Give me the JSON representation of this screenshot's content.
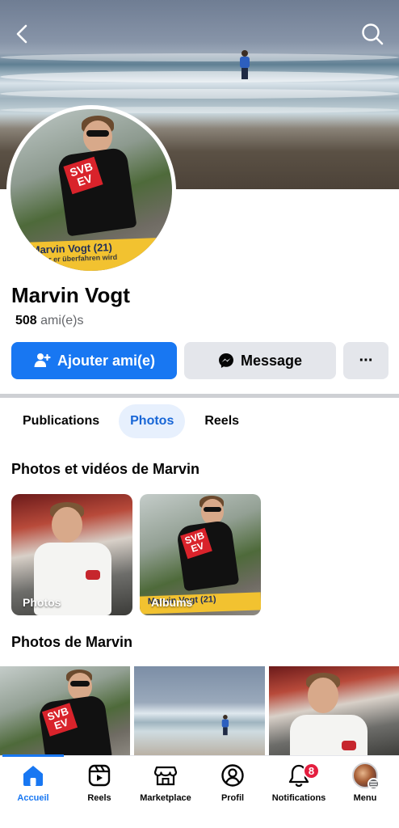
{
  "profile": {
    "name": "Marvin Vogt",
    "friends_count": "508",
    "friends_label": "ami(e)s",
    "avatar_banner": "Marvin Vogt (21)",
    "avatar_banner_sub": "bevor er überfahren wird"
  },
  "actions": {
    "add_friend": "Ajouter ami(e)",
    "message": "Message",
    "more": "···"
  },
  "tabs": [
    {
      "label": "Publications",
      "active": false
    },
    {
      "label": "Photos",
      "active": true
    },
    {
      "label": "Reels",
      "active": false
    }
  ],
  "sections": {
    "albums_title": "Photos et vidéos de Marvin",
    "photos_title": "Photos de Marvin"
  },
  "albums": [
    {
      "label": "Photos"
    },
    {
      "label": "Albums"
    }
  ],
  "shirt_logo": "SVB\nEV",
  "nav": {
    "items": [
      {
        "label": "Accueil",
        "icon": "home-icon",
        "active": true
      },
      {
        "label": "Reels",
        "icon": "reels-icon",
        "active": false
      },
      {
        "label": "Marketplace",
        "icon": "marketplace-icon",
        "active": false
      },
      {
        "label": "Profil",
        "icon": "profile-icon",
        "active": false
      },
      {
        "label": "Notifications",
        "icon": "bell-icon",
        "active": false,
        "badge": "8"
      },
      {
        "label": "Menu",
        "icon": "menu-avatar",
        "active": false
      }
    ]
  },
  "colors": {
    "primary": "#1877f2",
    "active_tab_bg": "#e7f0fd",
    "badge": "#e41e3f"
  }
}
